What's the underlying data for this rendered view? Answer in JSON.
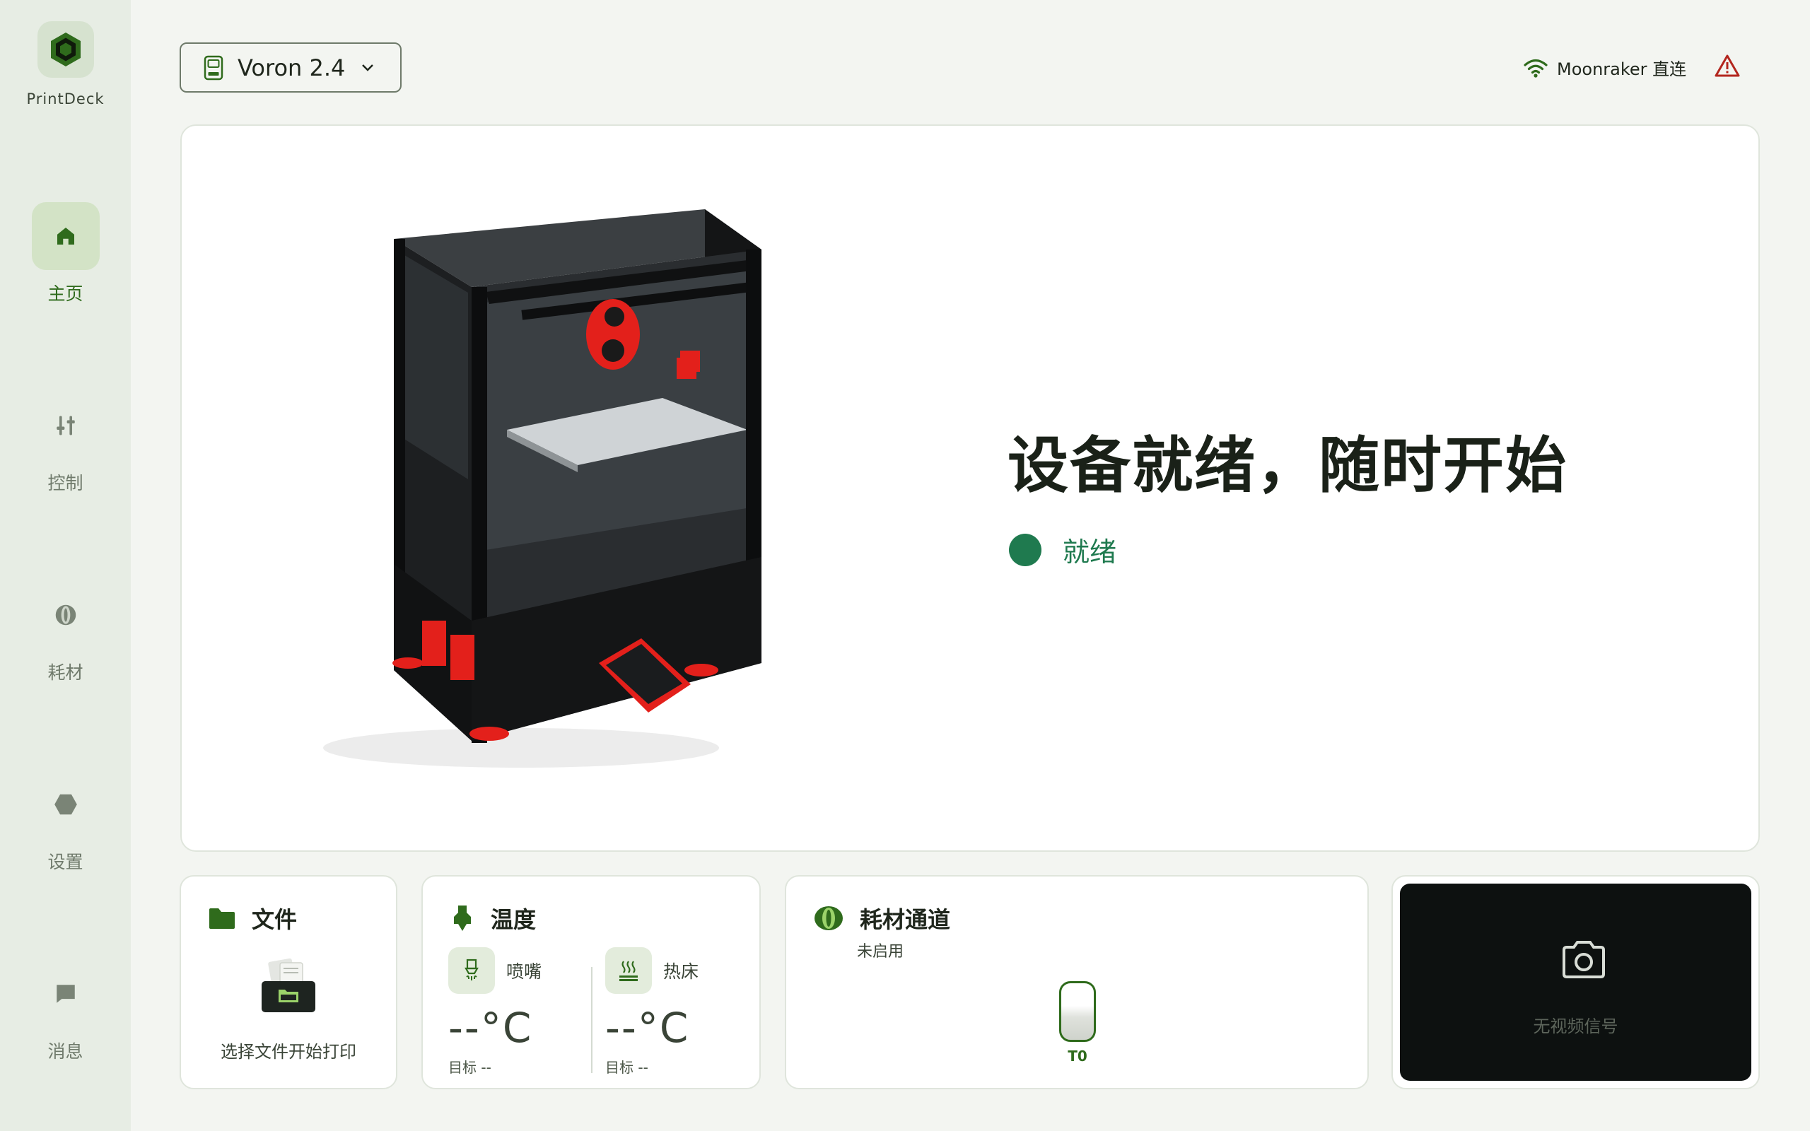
{
  "app": {
    "name": "PrintDeck"
  },
  "sidebar": {
    "items": [
      {
        "label": "主页",
        "icon": "home-icon",
        "active": true
      },
      {
        "label": "控制",
        "icon": "sliders-icon",
        "active": false
      },
      {
        "label": "耗材",
        "icon": "spool-icon",
        "active": false
      },
      {
        "label": "设置",
        "icon": "hexagon-icon",
        "active": false
      },
      {
        "label": "消息",
        "icon": "message-icon",
        "active": false
      }
    ]
  },
  "header": {
    "device": "Voron 2.4",
    "connection": "Moonraker 直连"
  },
  "hero": {
    "title": "设备就绪，随时开始",
    "status": "就绪"
  },
  "cards": {
    "files": {
      "title": "文件",
      "hint": "选择文件开始打印"
    },
    "temperature": {
      "title": "温度",
      "nozzle": {
        "label": "喷嘴",
        "value": "--°C",
        "target": "目标 --"
      },
      "bed": {
        "label": "热床",
        "value": "--°C",
        "target": "目标 --"
      }
    },
    "filament": {
      "title": "耗材通道",
      "status": "未启用",
      "slot": "T0"
    },
    "camera": {
      "message": "无视频信号"
    }
  },
  "colors": {
    "accent": "#2f6b1c",
    "ready": "#1f7a4f",
    "warning": "#b3261e",
    "sidebar_bg": "#e7ede4",
    "page_bg": "#f3f5f1"
  }
}
